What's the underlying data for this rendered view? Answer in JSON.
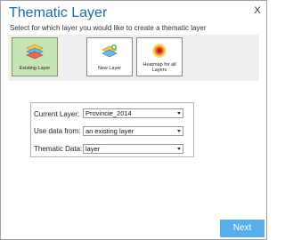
{
  "window": {
    "title": "Thematic Layer",
    "close_label": "X"
  },
  "subtitle": "Select for which layer you would like to create a thematic layer",
  "layer_options": [
    {
      "label": "Existing Layer",
      "selected": true,
      "icon": "stacked-layers-icon"
    },
    {
      "label": "New Layer",
      "selected": false,
      "icon": "new-layer-icon"
    },
    {
      "label_line1": "Heatmap for all",
      "label_line2": "Layers",
      "selected": false,
      "icon": "heatmap-icon"
    }
  ],
  "form": {
    "current_layer_label": "Current Layer:",
    "current_layer_value": "Provincie_2014",
    "use_data_label": "Use data from:",
    "use_data_value": "an existing layer",
    "thematic_data_label": "Thematic Data:",
    "thematic_data_value": "layer"
  },
  "next_button": {
    "label": "Next",
    "color": "#58aee8"
  },
  "colors": {
    "title": "#1f6ba8",
    "selected_option": "#c6e4b4",
    "panel_bg": "#efefef"
  }
}
